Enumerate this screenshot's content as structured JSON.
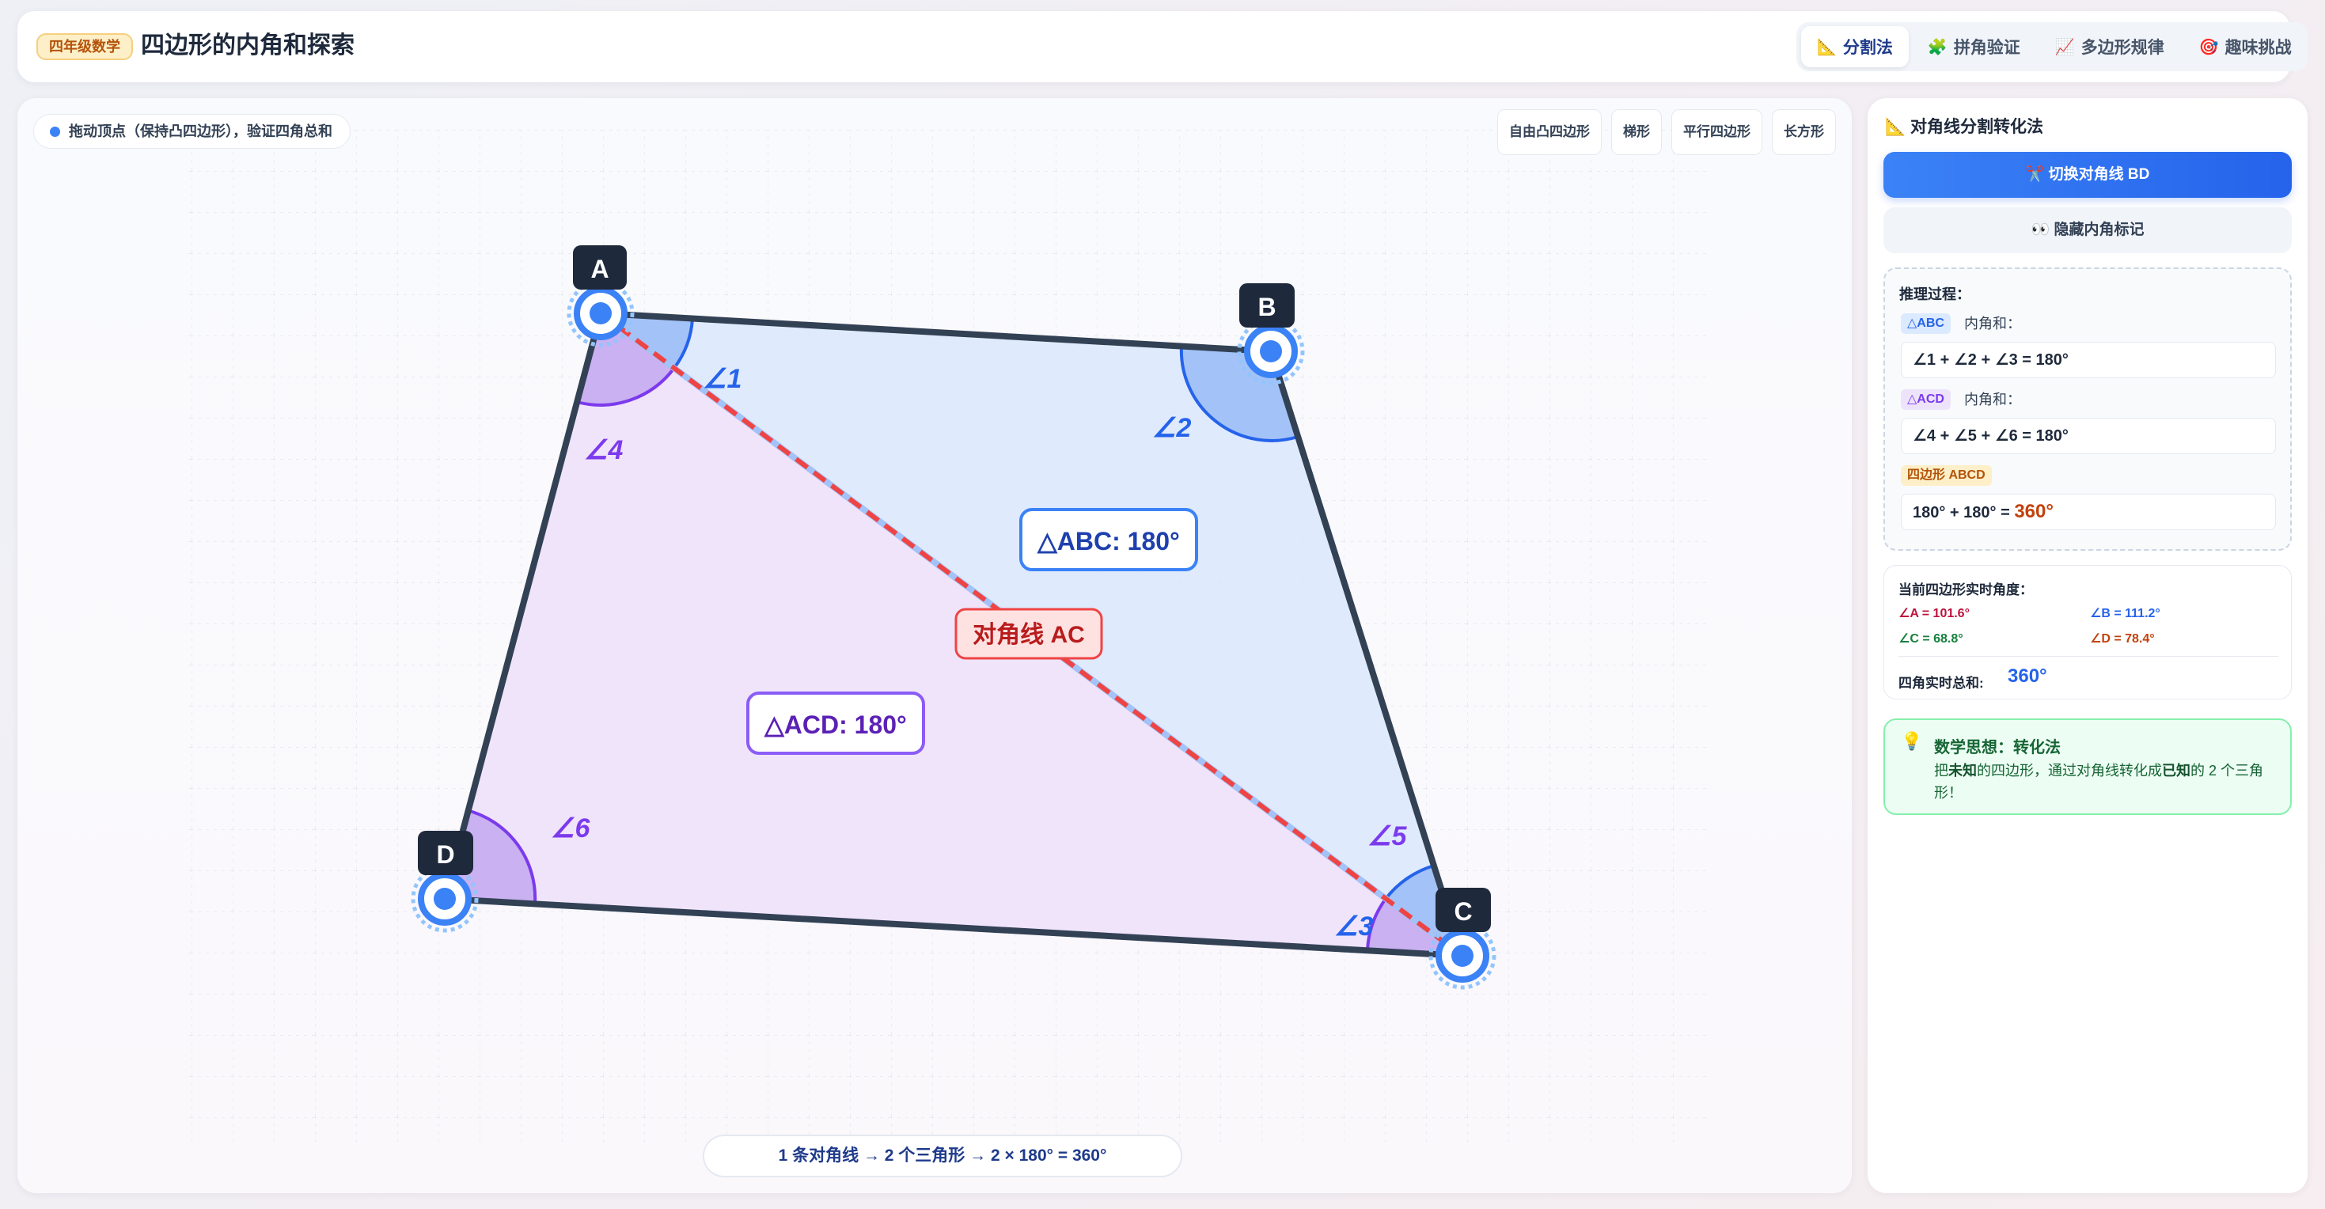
{
  "header": {
    "grade": "四年级数学",
    "title": "四边形的内角和探索",
    "tabs": [
      {
        "icon": "📐",
        "label": "分割法",
        "active": true
      },
      {
        "icon": "🧩",
        "label": "拼角验证",
        "active": false
      },
      {
        "icon": "📈",
        "label": "多边形规律",
        "active": false
      },
      {
        "icon": "🎯",
        "label": "趣味挑战",
        "active": false
      }
    ]
  },
  "canvas": {
    "hint": "拖动顶点（保持凸四边形），验证四角总和",
    "shape_buttons": [
      "自由凸四边形",
      "梯形",
      "平行四边形",
      "长方形"
    ],
    "vertex_labels": {
      "A": "A",
      "B": "B",
      "C": "C",
      "D": "D"
    },
    "angle_labels": [
      "∠1",
      "∠2",
      "∠3",
      "∠4",
      "∠5",
      "∠6"
    ],
    "triangle_abc": "△ABC: 180°",
    "triangle_acd": "△ACD: 180°",
    "diagonal_label": "对角线 AC",
    "bottom_formula": "1 条对角线 → 2 个三角形 → 2 × 180° = 360°",
    "colors": {
      "blue_fill": "#dbe8fd",
      "purple_fill": "#efe3fb",
      "outline": "#334155",
      "diagonal": "#ef4444",
      "vertex": "#3b82f6"
    }
  },
  "side": {
    "title": "📐 对角线分割转化法",
    "btn_switch": "✂️ 切换对角线 BD",
    "btn_hide": "👀 隐藏内角标记",
    "reasoning": {
      "title": "推理过程：",
      "abc_tag": "△ABC",
      "abc_suffix": "内角和：",
      "abc_eq": "∠1 + ∠2 + ∠3 = 180°",
      "acd_tag": "△ACD",
      "acd_suffix": "内角和：",
      "acd_eq": "∠4 + ∠5 + ∠6 = 180°",
      "quad_tag": "四边形 ABCD",
      "quad_eq_prefix": "180° + 180° = ",
      "quad_eq_result": "360°"
    },
    "angles": {
      "title": "当前四边形实时角度：",
      "a": "∠A = 101.6°",
      "b": "∠B = 111.2°",
      "c": "∠C = 68.8°",
      "d": "∠D = 78.4°",
      "total_label": "四角实时总和:",
      "total_value": "360°"
    },
    "idea": {
      "icon": "💡",
      "title": "数学思想：转化法",
      "text_1": "把",
      "text_unknown": "未知",
      "text_2": "的四边形，通过对角线转化成",
      "text_known": "已知",
      "text_3": "的 2 个三角形！"
    }
  }
}
